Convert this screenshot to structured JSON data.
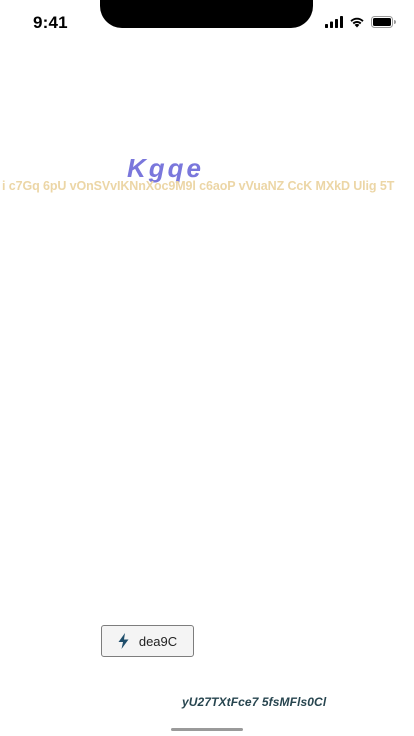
{
  "status_bar": {
    "time": "9:41",
    "icons": [
      "cellular-signal-icon",
      "wifi-icon",
      "battery-icon"
    ]
  },
  "main": {
    "headline": "Kgqe",
    "marquee_text": "i  c7Gq 6pU vOnSVvIKNnXoc9M9l c6aoP vVuaNZ CcK MXkD  Ulig 5T",
    "action_button": {
      "label": "dea9C",
      "icon": "lightning-bolt-icon"
    },
    "footer_text": "yU27TXtFce7 5fsMFls0Cl"
  },
  "colors": {
    "headline": "#7a77dc",
    "marquee": "#ecd6a6",
    "footer": "#27454f",
    "bolt": "#1f4e6b"
  }
}
